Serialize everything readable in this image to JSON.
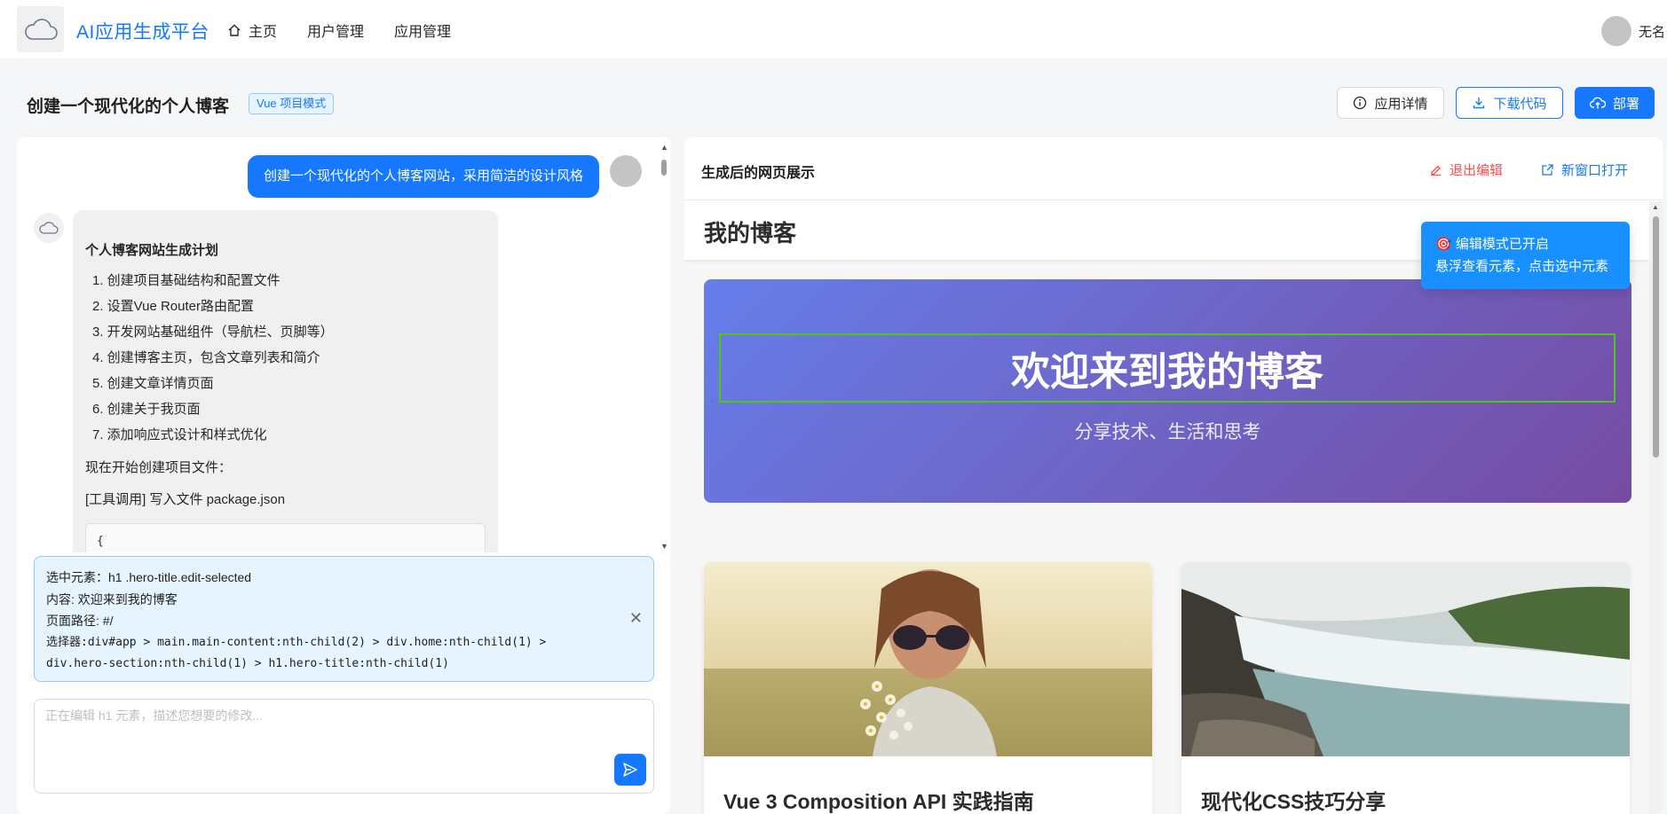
{
  "app": {
    "title": "AI应用生成平台"
  },
  "nav": {
    "items": [
      {
        "label": "主页",
        "icon": "home-icon"
      },
      {
        "label": "用户管理"
      },
      {
        "label": "应用管理"
      }
    ]
  },
  "user": {
    "name": "无名"
  },
  "page": {
    "title": "创建一个现代化的个人博客",
    "mode_tag": "Vue 项目模式"
  },
  "actions": {
    "details": "应用详情",
    "download": "下载代码",
    "deploy": "部署"
  },
  "chat": {
    "user_message": "创建一个现代化的个人博客网站，采用简洁的设计风格",
    "ai_heading": "个人博客网站生成计划",
    "ai_steps": [
      "1. 创建项目基础结构和配置文件",
      "2. 设置Vue Router路由配置",
      "3. 开发网站基础组件（导航栏、页脚等）",
      "4. 创建博客主页，包含文章列表和简介",
      "5. 创建文章详情页面",
      "6. 创建关于我页面",
      "7. 添加响应式设计和样式优化"
    ],
    "ai_para": "现在开始创建项目文件：",
    "ai_tool": "[工具调用] 写入文件 package.json",
    "code_preview": "{",
    "selected": {
      "element": "选中元素：h1 .hero-title.edit-selected",
      "content": "内容: 欢迎来到我的博客",
      "path": "页面路径: #/",
      "selector_1": "选择器:div#app > main.main-content:nth-child(2) > div.home:nth-child(1) >",
      "selector_2": "div.hero-section:nth-child(1) > h1.hero-title:nth-child(1)"
    },
    "input_placeholder": "正在编辑 h1 元素，描述您想要的修改..."
  },
  "preview": {
    "title": "生成后的网页展示",
    "exit_edit": "退出编辑",
    "open_new_window": "新窗口打开",
    "site": {
      "title": "我的博客",
      "hero_title": "欢迎来到我的博客",
      "hero_subtitle": "分享技术、生活和思考",
      "cards": [
        {
          "title": "Vue 3 Composition API 实践指南"
        },
        {
          "title": "现代化CSS技巧分享"
        }
      ]
    },
    "toast": {
      "line1": "🎯 编辑模式已开启",
      "line2": "悬浮查看元素，点击选中元素"
    }
  },
  "colors": {
    "primary": "#1677ff",
    "danger": "#ff4d4f",
    "hero_from": "#667eea",
    "hero_to": "#764ba2",
    "selected_outline": "#52c41a"
  }
}
